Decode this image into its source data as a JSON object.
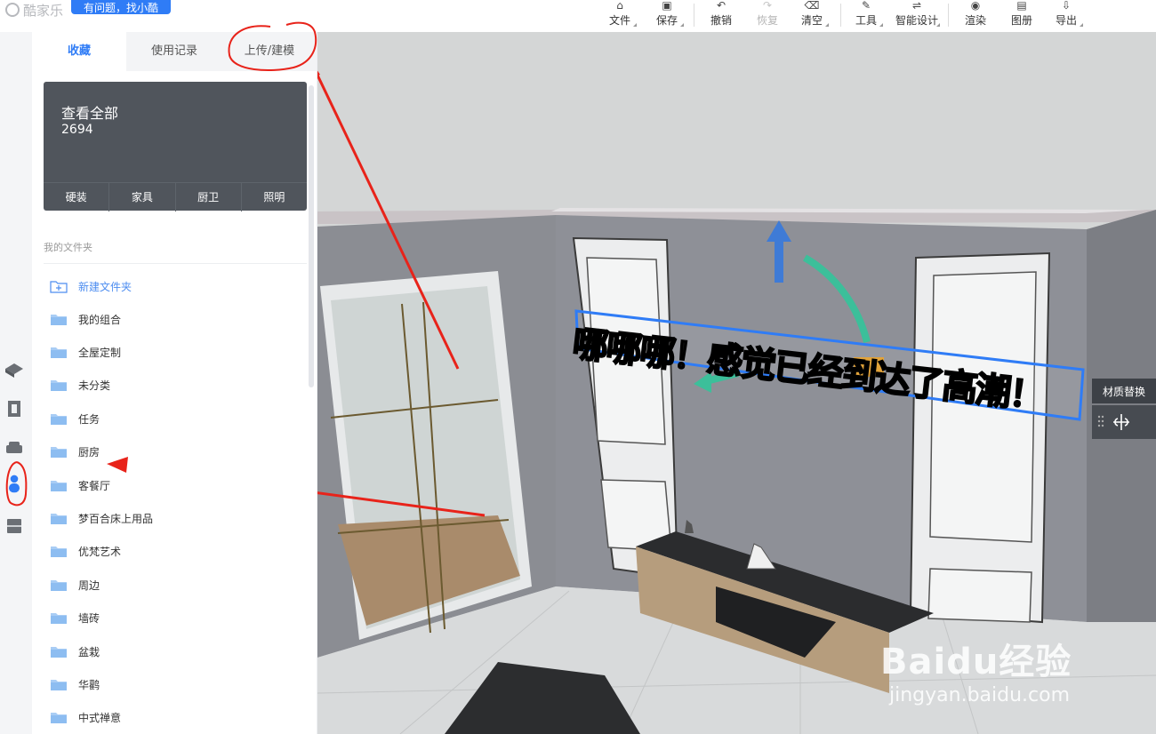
{
  "app": {
    "logo_text": "酷家乐",
    "help_button": "有问题，找小酷"
  },
  "toolbar": [
    {
      "label": "文件",
      "icon": "home-icon"
    },
    {
      "label": "保存",
      "icon": "save-icon"
    },
    {
      "label": "撤销",
      "icon": "undo-icon"
    },
    {
      "label": "恢复",
      "icon": "redo-icon",
      "disabled": true
    },
    {
      "label": "清空",
      "icon": "eraser-icon"
    },
    {
      "label": "工具",
      "icon": "wrench-icon"
    },
    {
      "label": "智能设计",
      "icon": "smart-design-icon"
    },
    {
      "label": "渲染",
      "icon": "render-icon"
    },
    {
      "label": "图册",
      "icon": "album-icon"
    },
    {
      "label": "导出",
      "icon": "export-icon"
    }
  ],
  "panel": {
    "tabs": [
      "收藏",
      "使用记录",
      "上传/建模"
    ],
    "active_tab": "收藏",
    "card": {
      "title": "查看全部",
      "count": "2694",
      "categories": [
        "硬装",
        "家具",
        "厨卫",
        "照明"
      ]
    },
    "folders_title": "我的文件夹",
    "new_folder": "新建文件夹",
    "folders": [
      "我的组合",
      "全屋定制",
      "未分类",
      "任务",
      "厨房",
      "客餐厅",
      "梦百合床上用品",
      "优梵艺术",
      "周边",
      "墙砖",
      "盆栽",
      "华鹳",
      "中式禅意"
    ]
  },
  "scene": {
    "banner_text": "哪哪哪！感觉已经到达了高潮！"
  },
  "right_tool": {
    "label": "材质替换"
  },
  "watermark": {
    "logo": "Baidu经验",
    "url": "jingyan.baidu.com"
  },
  "colors": {
    "accent": "#2f7cf6",
    "annotation": "#e8231a",
    "card_bg": "#50555c"
  }
}
